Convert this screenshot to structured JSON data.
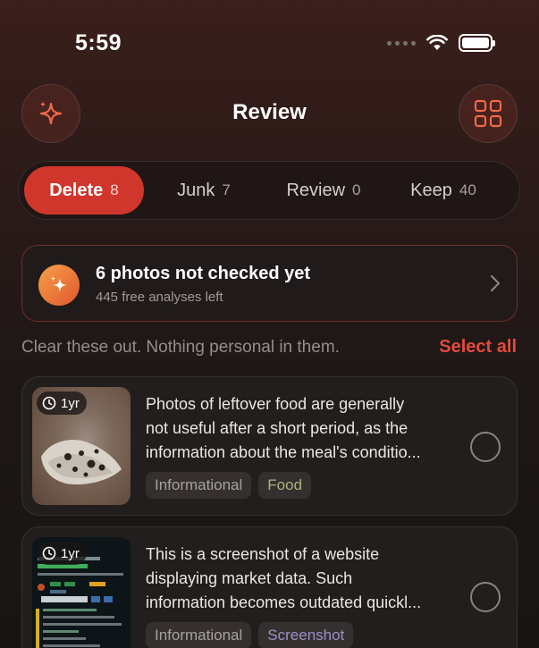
{
  "status": {
    "time": "5:59"
  },
  "header": {
    "title": "Review",
    "left_icon": "sparkles-icon",
    "right_icon": "grid-icon"
  },
  "tabs": [
    {
      "label": "Delete",
      "count": "8",
      "active": true
    },
    {
      "label": "Junk",
      "count": "7",
      "active": false
    },
    {
      "label": "Review",
      "count": "0",
      "active": false
    },
    {
      "label": "Keep",
      "count": "40",
      "active": false
    }
  ],
  "banner": {
    "title": "6 photos not checked yet",
    "subtitle": "445 free analyses left"
  },
  "section": {
    "hint": "Clear these out. Nothing personal in them.",
    "select_all": "Select all"
  },
  "items": [
    {
      "age": "1yr",
      "lines": [
        "Photos of leftover food are generally",
        "not useful after a short period, as the",
        "information about the meal's conditio..."
      ],
      "tags": [
        "Informational",
        "Food"
      ]
    },
    {
      "age": "1yr",
      "lines": [
        "This is a screenshot of a website",
        "displaying market data. Such",
        "information becomes outdated quickl..."
      ],
      "tags": [
        "Informational",
        "Screenshot"
      ]
    }
  ],
  "colors": {
    "accent": "#d0362c",
    "select_all": "#e44a3e",
    "banner_border": "#d24632"
  }
}
